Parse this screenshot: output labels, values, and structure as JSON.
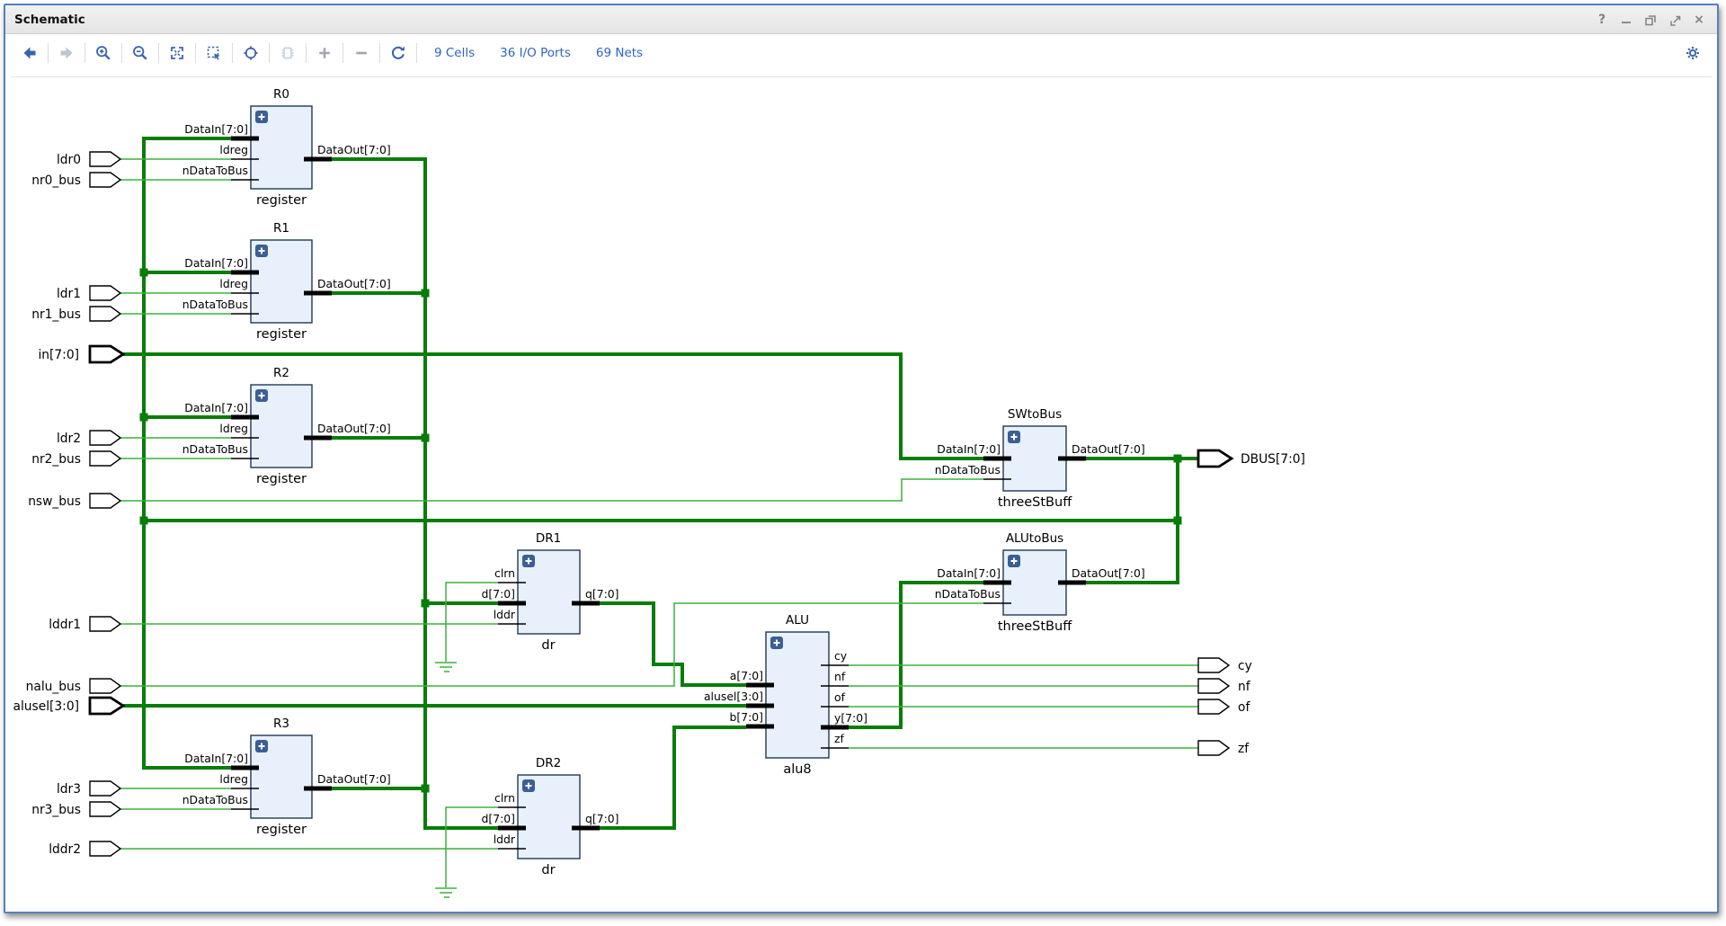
{
  "titlebar": {
    "title": "Schematic",
    "help_label": "?",
    "close_label": "×"
  },
  "toolbar": {
    "cells_link": "9 Cells",
    "io_ports_link": "36 I/O Ports",
    "nets_link": "69 Nets"
  },
  "colors": {
    "accent_blue": "#3a64ad",
    "bus_green": "#077d07",
    "net_green": "#3cb03c",
    "block_fill": "#e8f1fb",
    "block_border": "#203a52",
    "frame_blue": "#5580c0"
  },
  "cells": [
    {
      "name": "R0",
      "type": "register",
      "pins": {
        "left": [
          "DataIn[7:0]",
          "ldreg",
          "nDataToBus"
        ],
        "right": [
          "DataOut[7:0]"
        ]
      }
    },
    {
      "name": "R1",
      "type": "register",
      "pins": {
        "left": [
          "DataIn[7:0]",
          "ldreg",
          "nDataToBus"
        ],
        "right": [
          "DataOut[7:0]"
        ]
      }
    },
    {
      "name": "R2",
      "type": "register",
      "pins": {
        "left": [
          "DataIn[7:0]",
          "ldreg",
          "nDataToBus"
        ],
        "right": [
          "DataOut[7:0]"
        ]
      }
    },
    {
      "name": "R3",
      "type": "register",
      "pins": {
        "left": [
          "DataIn[7:0]",
          "ldreg",
          "nDataToBus"
        ],
        "right": [
          "DataOut[7:0]"
        ]
      }
    },
    {
      "name": "DR1",
      "type": "dr",
      "pins": {
        "left": [
          "clrn",
          "d[7:0]",
          "lddr"
        ],
        "right": [
          "q[7:0]"
        ]
      }
    },
    {
      "name": "DR2",
      "type": "dr",
      "pins": {
        "left": [
          "clrn",
          "d[7:0]",
          "lddr"
        ],
        "right": [
          "q[7:0]"
        ]
      }
    },
    {
      "name": "ALU",
      "type": "alu8",
      "pins": {
        "left": [
          "a[7:0]",
          "alusel[3:0]",
          "b[7:0]"
        ],
        "right": [
          "cy",
          "nf",
          "of",
          "y[7:0]",
          "zf"
        ]
      }
    },
    {
      "name": "SWtoBus",
      "type": "threeStBuff",
      "pins": {
        "left": [
          "DataIn[7:0]",
          "nDataToBus"
        ],
        "right": [
          "DataOut[7:0]"
        ]
      }
    },
    {
      "name": "ALUtoBus",
      "type": "threeStBuff",
      "pins": {
        "left": [
          "DataIn[7:0]",
          "nDataToBus"
        ],
        "right": [
          "DataOut[7:0]"
        ]
      }
    }
  ],
  "io": {
    "inputs": [
      "ldr0",
      "nr0_bus",
      "ldr1",
      "nr1_bus",
      "in[7:0]",
      "ldr2",
      "nr2_bus",
      "nsw_bus",
      "lddr1",
      "nalu_bus",
      "alusel[3:0]",
      "ldr3",
      "nr3_bus",
      "lddr2"
    ],
    "outputs": [
      "DBUS[7:0]",
      "cy",
      "nf",
      "of",
      "zf"
    ]
  }
}
